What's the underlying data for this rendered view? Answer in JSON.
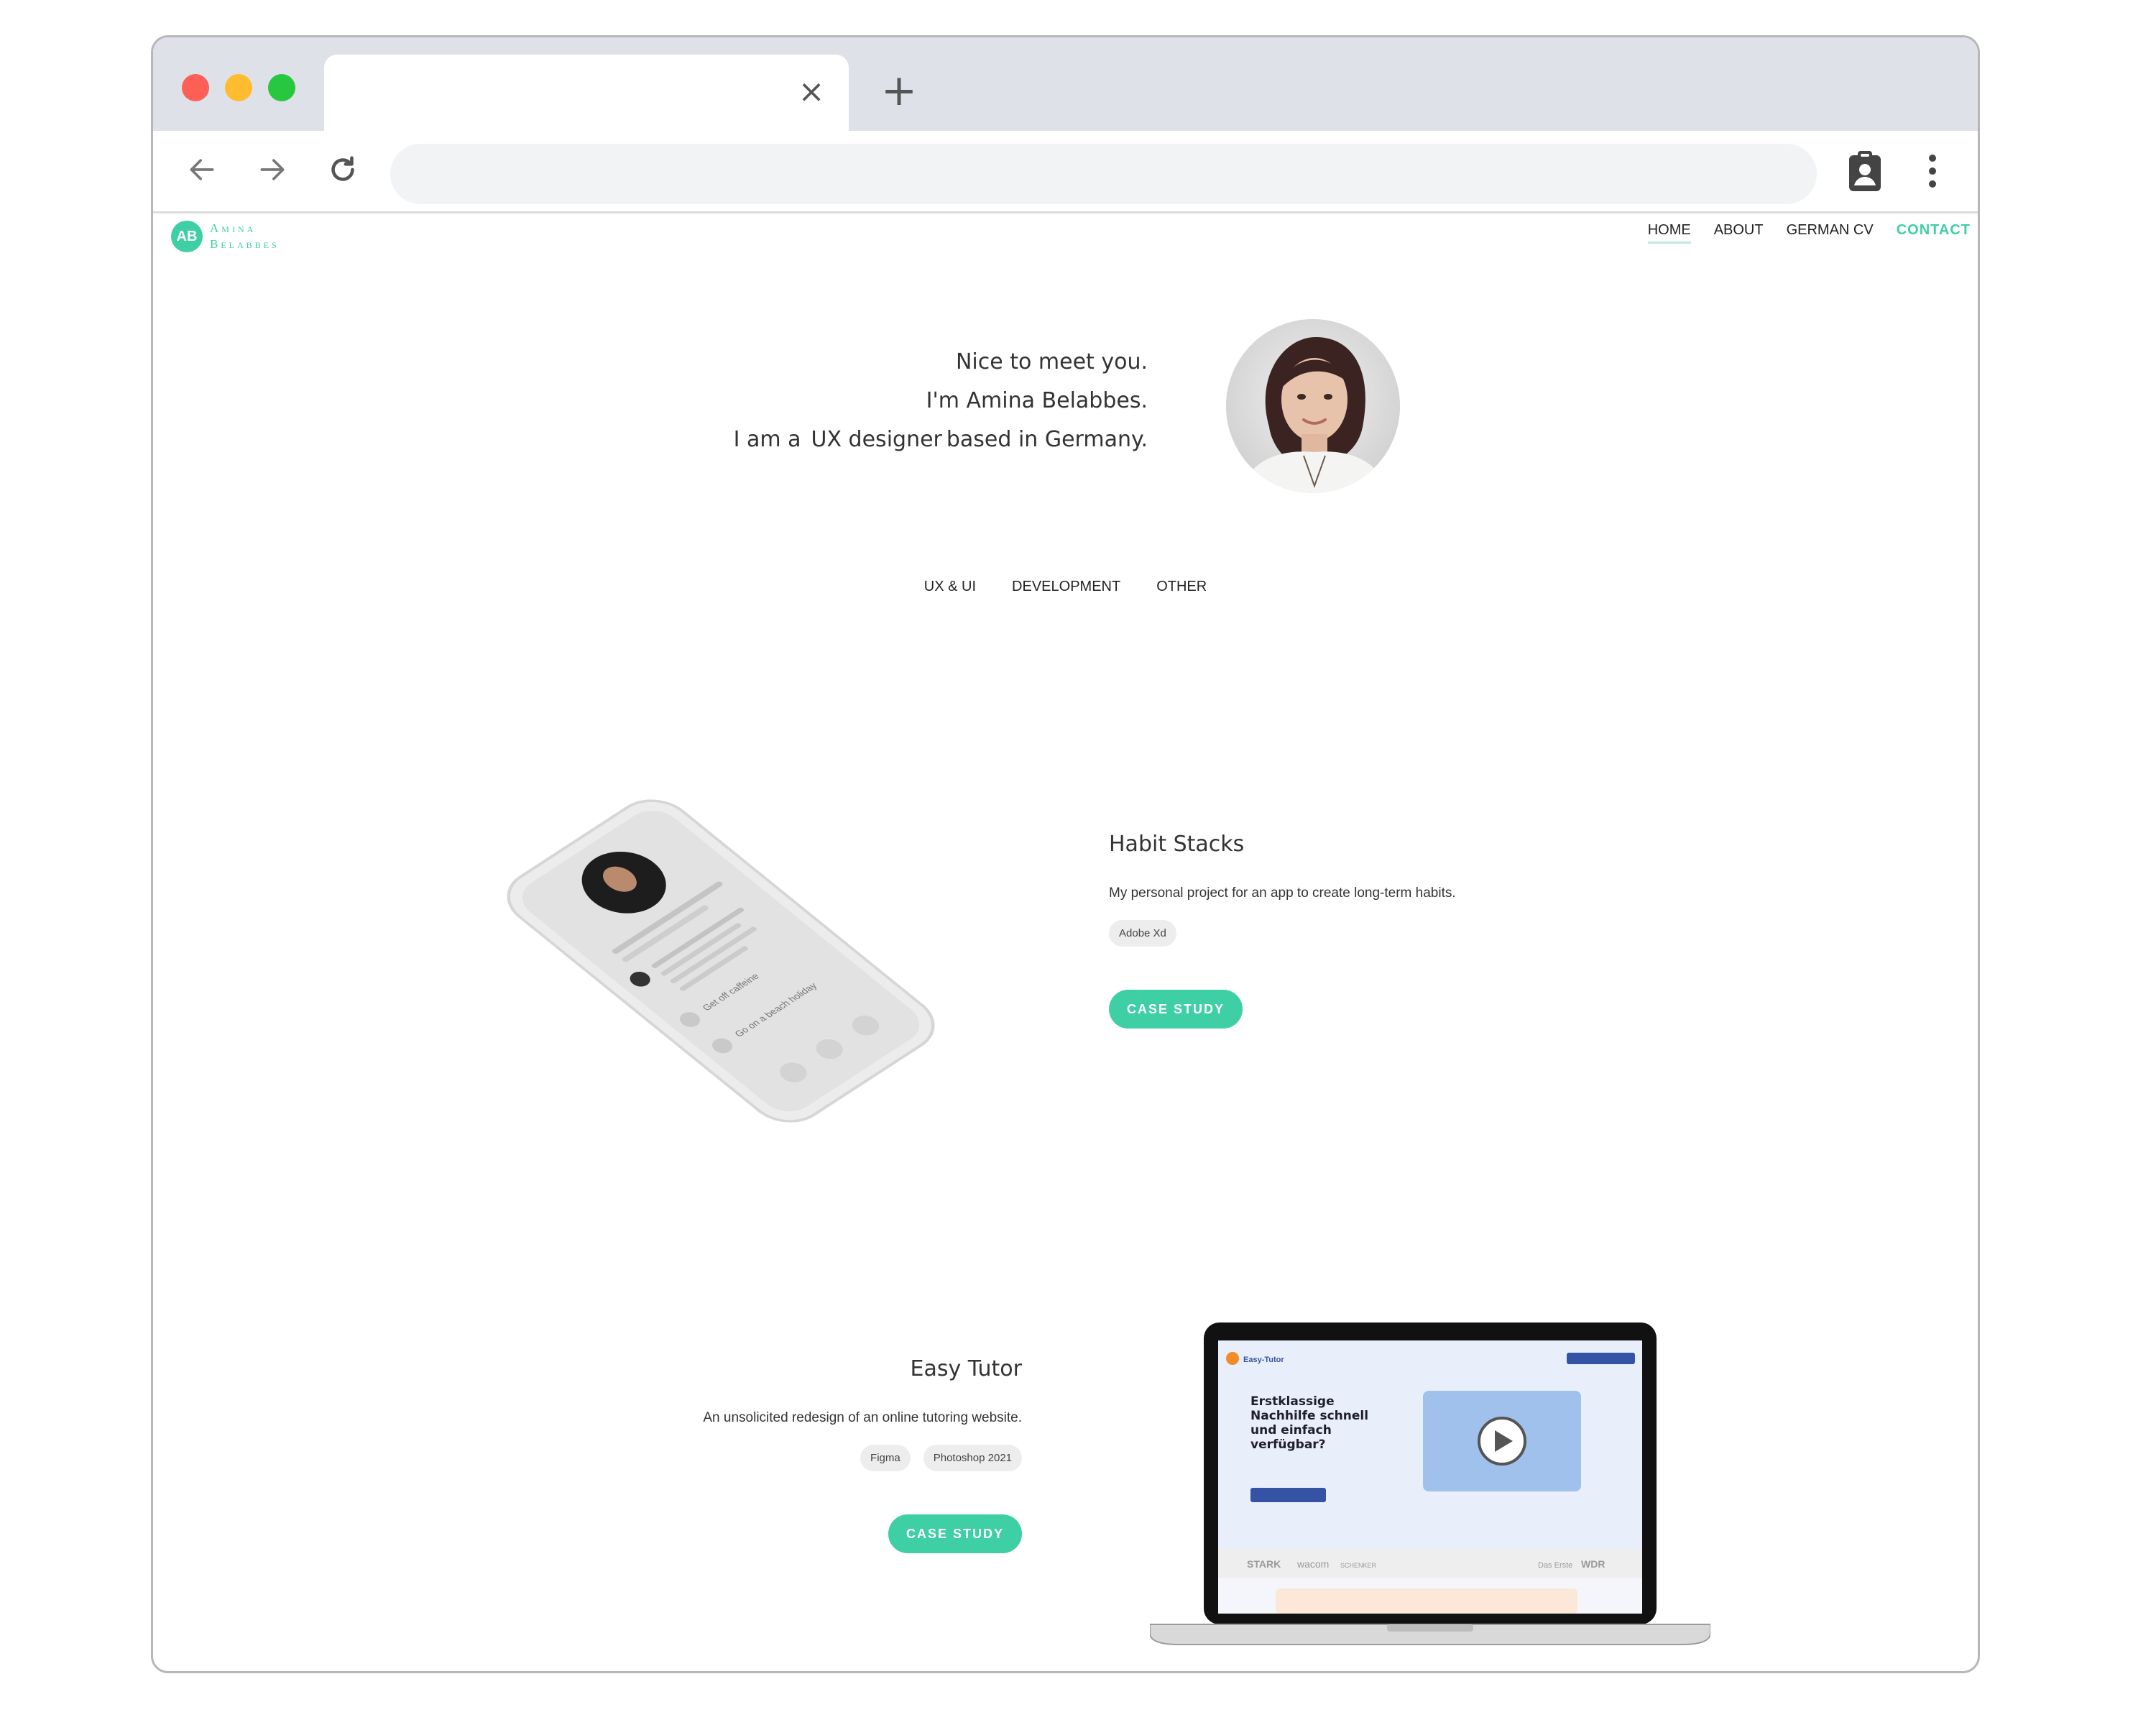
{
  "browser": {
    "tab_close_label": "×",
    "new_tab_label": "+",
    "address_value": ""
  },
  "site": {
    "logo_mark": "AB",
    "logo_line1": "Amina",
    "logo_line2": "Belabbes",
    "nav": {
      "home": "HOME",
      "about": "ABOUT",
      "german_cv": "GERMAN CV",
      "contact": "CONTACT"
    },
    "intro": {
      "line1": "Nice to meet you.",
      "line2": "I'm Amina Belabbes.",
      "line3_prefix": "I am a",
      "line3_role": "UX designer",
      "line3_suffix": "based in Germany."
    },
    "filters": [
      "UX & UI",
      "DEVELOPMENT",
      "OTHER"
    ]
  },
  "projects": [
    {
      "title": "Habit Stacks",
      "description": "My personal project for an app to create long-term habits.",
      "tags": [
        "Adobe Xd"
      ],
      "cta": "CASE STUDY"
    },
    {
      "title": "Easy Tutor",
      "description": "An unsolicited redesign of an online tutoring website.",
      "tags": [
        "Figma",
        "Photoshop 2021"
      ],
      "cta": "CASE STUDY"
    }
  ],
  "phone_screen": {
    "items": [
      "Get off caffeine",
      "Go on a beach holiday"
    ]
  },
  "laptop_screen": {
    "brand": "Easy-Tutor",
    "headline": [
      "Erstklassige",
      "Nachhilfe schnell",
      "und einfach",
      "verfügbar?"
    ],
    "logos": [
      "STARK",
      "wacom",
      "SCHENKER",
      "Das Erste",
      "WDR"
    ]
  },
  "colors": {
    "accent": "#3ecfa4",
    "tab_bar": "#dee1e7",
    "address_bar": "#f1f3f4",
    "traffic_red": "#fd5f57",
    "traffic_yellow": "#febc2e",
    "traffic_green": "#27c83f"
  }
}
